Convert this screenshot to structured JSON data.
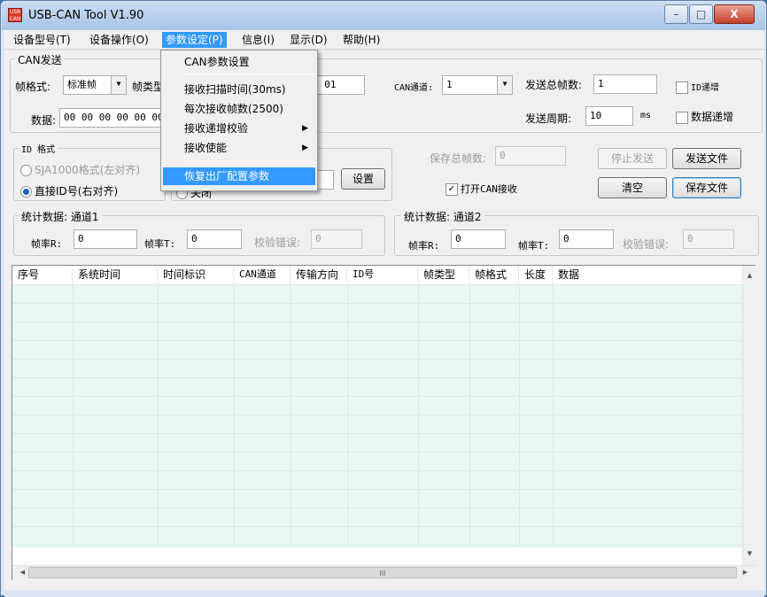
{
  "window": {
    "title": "USB-CAN Tool V1.90",
    "icon_text": "USB CAN",
    "buttons": {
      "minimize": "–",
      "maximize": "□",
      "close": "X"
    }
  },
  "menubar": {
    "items": [
      {
        "label": "设备型号(T)"
      },
      {
        "label": "设备操作(O)"
      },
      {
        "label": "参数设定(P)"
      },
      {
        "label": "信息(I)"
      },
      {
        "label": "显示(D)"
      },
      {
        "label": "帮助(H)"
      }
    ],
    "active_index": 2
  },
  "dropdown": {
    "items": [
      {
        "label": "CAN参数设置"
      },
      {
        "label": "接收扫描时间(30ms)"
      },
      {
        "label": "每次接收帧数(2500)"
      },
      {
        "label": "接收递增校验",
        "submenu_arrow": "▶"
      },
      {
        "label": "接收使能",
        "submenu_arrow": "▶"
      },
      {
        "label": "恢复出厂配置参数"
      }
    ]
  },
  "can_send": {
    "group_title": "CAN发送",
    "frame_format_label": "帧格式:",
    "frame_format_value": "标准帧",
    "frame_type_label_partial": "帧类型",
    "frame_id_value_partial": "0 01",
    "channel_label": "CAN通道:",
    "channel_value": "1",
    "total_frames_label": "发送总帧数:",
    "total_frames_value": "1",
    "id_increment_label": "ID递增",
    "data_label": "数据:",
    "data_value": "00 00 00 00 00 00",
    "period_label": "发送周期:",
    "period_value": "10",
    "period_unit": "ms",
    "data_increment_label": "数据递增",
    "dropdown_arrow": "▼"
  },
  "id_format": {
    "group_title": "ID 格式",
    "option_sja1000": "SJA1000格式(左对齐)",
    "option_direct": "直接ID号(右对齐)",
    "partial_radio_label": "关闭",
    "set_button": "设置"
  },
  "receive": {
    "save_total_label": "保存总帧数:",
    "save_total_value": "0",
    "open_can_receive_label": "打开CAN接收",
    "open_can_receive_checked": true,
    "stop_send_button": "停止发送",
    "send_file_button": "发送文件",
    "clear_button": "清空",
    "save_file_button": "保存文件"
  },
  "stats1": {
    "group_title": "统计数据: 通道1",
    "rate_r_label": "帧率R:",
    "rate_r_value": "0",
    "rate_t_label": "帧率T:",
    "rate_t_value": "0",
    "check_err_label": "校验错误:",
    "check_err_value": "0"
  },
  "stats2": {
    "group_title": "统计数据: 通道2",
    "rate_r_label": "帧率R:",
    "rate_r_value": "0",
    "rate_t_label": "帧率T:",
    "rate_t_value": "0",
    "check_err_label": "校验错误:",
    "check_err_value": "0"
  },
  "table": {
    "columns": [
      "序号",
      "系统时间",
      "时间标识",
      "CAN通道",
      "传输方向",
      "ID号",
      "帧类型",
      "帧格式",
      "长度",
      "数据"
    ],
    "scroll_up": "▲",
    "scroll_down": "▼",
    "scroll_left": "◀",
    "scroll_right": "▶",
    "hscroll_grip": "III"
  },
  "colors": {
    "accent": "#3399ff",
    "table_background": "#e8f8f4"
  }
}
